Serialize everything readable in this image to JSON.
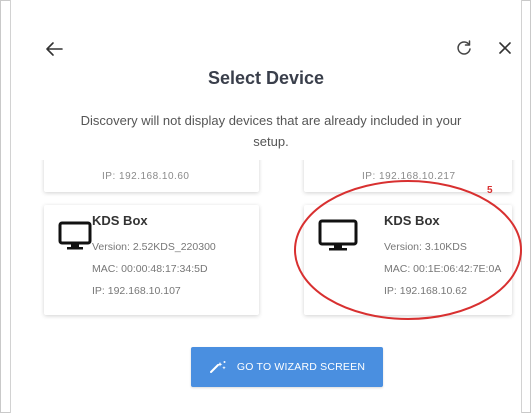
{
  "dialog": {
    "title": "Select Device",
    "subtitle": "Discovery will not display devices that are already included in your setup."
  },
  "icons": {
    "back": "arrow-left-icon",
    "refresh": "refresh-icon",
    "close": "close-icon",
    "monitor": "monitor-icon",
    "wand": "magic-wand-icon"
  },
  "colors": {
    "accent": "#4a8fe0",
    "annotation": "#d83030",
    "title": "#3a3f4b"
  },
  "devices": [
    {
      "name": "KDS Box",
      "version": "Version: 2.52KDS_220300",
      "mac": "MAC: 00:00:48:17:34:5D",
      "ip": "IP: 192.168.10.107"
    },
    {
      "name": "KDS Box",
      "version": "Version: 3.10KDS",
      "mac": "MAC: 00:1E:06:42:7E:0A",
      "ip": "IP: 192.168.10.62"
    }
  ],
  "partial_cards": {
    "left_ip": "IP: 192.168.10.60",
    "right_ip": "IP: 192.168.10.217"
  },
  "annotation": {
    "label": "5"
  },
  "cta": {
    "label": "GO TO WIZARD SCREEN"
  }
}
